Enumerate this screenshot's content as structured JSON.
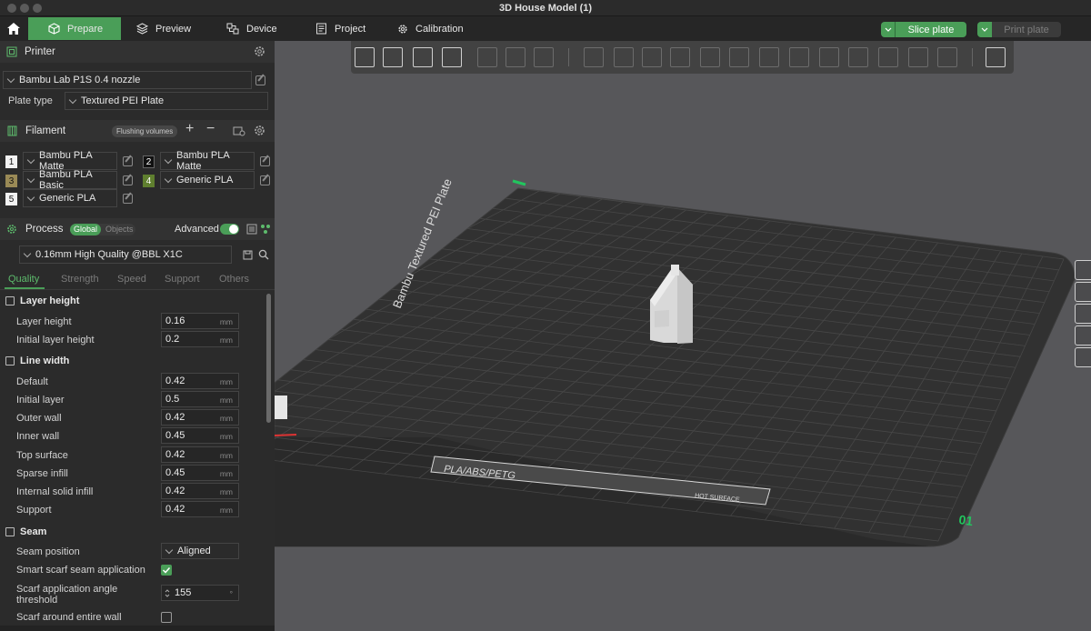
{
  "window": {
    "title": "3D House Model (1)"
  },
  "tabs": {
    "prepare": "Prepare",
    "preview": "Preview",
    "device": "Device",
    "project": "Project",
    "calibration": "Calibration"
  },
  "actions": {
    "slice_plate": "Slice plate",
    "print_plate": "Print plate"
  },
  "printer": {
    "title": "Printer",
    "model": "Bambu Lab P1S 0.4 nozzle",
    "plate_type_label": "Plate type",
    "plate_type": "Textured PEI Plate"
  },
  "filament": {
    "title": "Filament",
    "flushing_button": "Flushing volumes",
    "slots": [
      {
        "num": "1",
        "name": "Bambu PLA Matte",
        "color": "#f2f2f2"
      },
      {
        "num": "2",
        "name": "Bambu PLA Matte",
        "color": "#111111"
      },
      {
        "num": "3",
        "name": "Bambu PLA Basic",
        "color": "#9a8a56"
      },
      {
        "num": "4",
        "name": "Generic PLA",
        "color": "#5f7f2f"
      },
      {
        "num": "5",
        "name": "Generic PLA",
        "color": "#f2f2f2"
      }
    ]
  },
  "process": {
    "title": "Process",
    "toggle_global": "Global",
    "toggle_objects": "Objects",
    "advanced_label": "Advanced",
    "advanced_on": true,
    "profile": "0.16mm High Quality @BBL X1C",
    "subtabs": [
      "Quality",
      "Strength",
      "Speed",
      "Support",
      "Others"
    ],
    "active_subtab": "Quality"
  },
  "settings": {
    "layer_height_group": "Layer height",
    "layer_height": {
      "label": "Layer height",
      "value": "0.16",
      "unit": "mm"
    },
    "initial_layer_height": {
      "label": "Initial layer height",
      "value": "0.2",
      "unit": "mm"
    },
    "line_width_group": "Line width",
    "line_widths": [
      {
        "label": "Default",
        "value": "0.42",
        "unit": "mm"
      },
      {
        "label": "Initial layer",
        "value": "0.5",
        "unit": "mm"
      },
      {
        "label": "Outer wall",
        "value": "0.42",
        "unit": "mm"
      },
      {
        "label": "Inner wall",
        "value": "0.45",
        "unit": "mm"
      },
      {
        "label": "Top surface",
        "value": "0.42",
        "unit": "mm"
      },
      {
        "label": "Sparse infill",
        "value": "0.45",
        "unit": "mm"
      },
      {
        "label": "Internal solid infill",
        "value": "0.42",
        "unit": "mm"
      },
      {
        "label": "Support",
        "value": "0.42",
        "unit": "mm"
      }
    ],
    "seam_group": "Seam",
    "seam_position": {
      "label": "Seam position",
      "value": "Aligned"
    },
    "smart_scarf": {
      "label": "Smart scarf seam application",
      "checked": true
    },
    "scarf_angle": {
      "label_line1": "Scarf application angle",
      "label_line2": "threshold",
      "value": "155",
      "unit": "°"
    },
    "scarf_entire_wall": {
      "label": "Scarf around entire wall",
      "checked": false
    }
  },
  "bed": {
    "brand_text": "Bambu Textured PEI Plate",
    "material_text": "PLA/ABS/PETG",
    "hot_surface_text": "HOT SURFACE",
    "plate_number": "01"
  },
  "colors": {
    "accent": "#4a9e58",
    "panel": "#2b2b2b",
    "viewport": "#57575a",
    "bed": "#313131",
    "plate_number": "#22c55e"
  }
}
